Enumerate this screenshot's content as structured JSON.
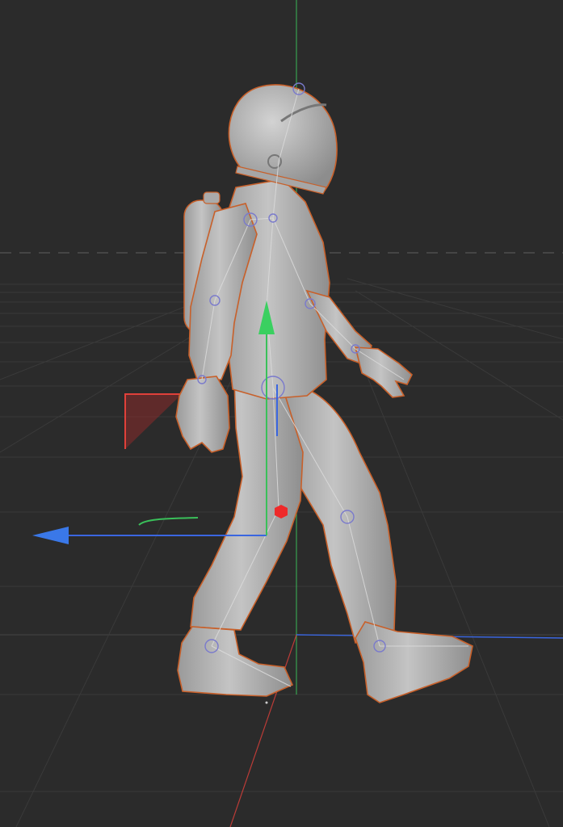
{
  "viewport": {
    "background": "#2b2b2b",
    "grid_color": "#3b3b3b",
    "axis_colors": {
      "x": "#e0403a",
      "y": "#3ac05a",
      "z": "#3a66e0"
    },
    "selection_outline": "#c8602a",
    "model_fill": "#b9b9b9",
    "rig_color": "#d6d6d6",
    "joint_color": "#7a7acc"
  },
  "scene_object": {
    "name_icon": "astronaut-model",
    "state": "selected"
  },
  "gizmo": {
    "type": "move-gizmo",
    "axes": [
      "x",
      "y",
      "z"
    ],
    "center_marker": "red-hexagon"
  }
}
